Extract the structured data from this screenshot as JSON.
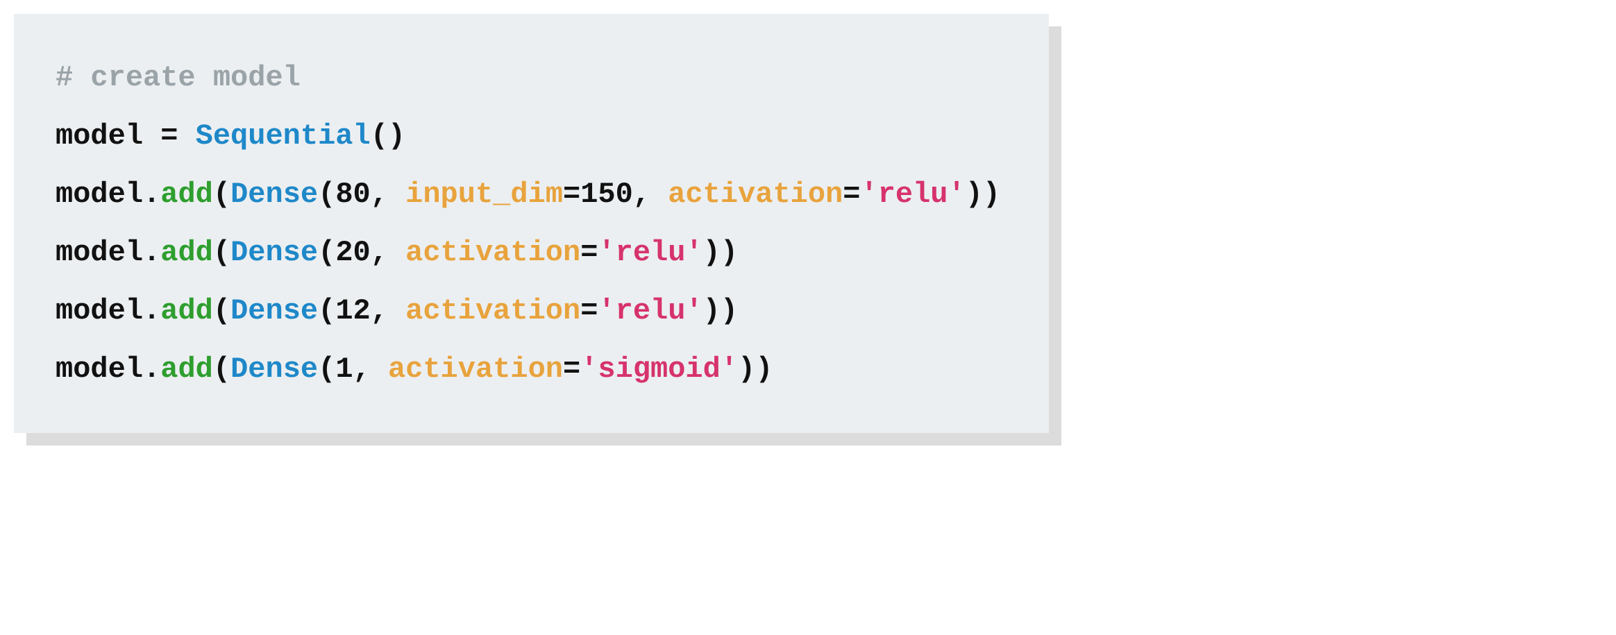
{
  "code": {
    "comment": "# create model",
    "line1": {
      "p1": "model = ",
      "class": "Sequential",
      "p2": "()"
    },
    "line2": {
      "p1": "model.",
      "method": "add",
      "p2": "(",
      "class": "Dense",
      "p3": "(80, ",
      "kw1": "input_dim",
      "p4": "=150, ",
      "kw2": "activation",
      "p5": "=",
      "str": "'relu'",
      "p6": "))"
    },
    "line3": {
      "p1": "model.",
      "method": "add",
      "p2": "(",
      "class": "Dense",
      "p3": "(20, ",
      "kw": "activation",
      "p4": "=",
      "str": "'relu'",
      "p5": "))"
    },
    "line4": {
      "p1": "model.",
      "method": "add",
      "p2": "(",
      "class": "Dense",
      "p3": "(12, ",
      "kw": "activation",
      "p4": "=",
      "str": "'relu'",
      "p5": "))"
    },
    "line5": {
      "p1": "model.",
      "method": "add",
      "p2": "(",
      "class": "Dense",
      "p3": "(1, ",
      "kw": "activation",
      "p4": "=",
      "str": "'sigmoid'",
      "p5": "))"
    }
  }
}
